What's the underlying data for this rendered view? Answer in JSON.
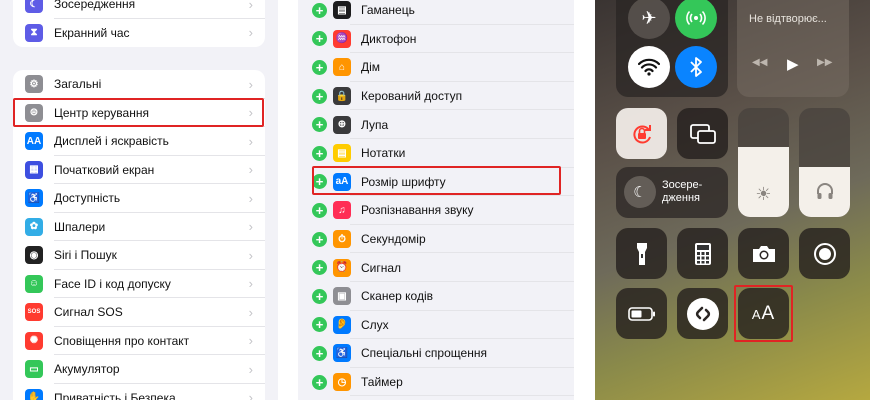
{
  "settings_top": {
    "items": [
      {
        "label": "Зосередження",
        "icon": "moon-icon",
        "color": "#5e5ce6",
        "glyph": "☾"
      },
      {
        "label": "Екранний час",
        "icon": "hourglass-icon",
        "color": "#5e5ce6",
        "glyph": "⧗"
      }
    ]
  },
  "settings_main": {
    "items": [
      {
        "label": "Загальні",
        "icon": "gear-icon",
        "color": "#8e8e93",
        "glyph": "⚙"
      },
      {
        "label": "Центр керування",
        "icon": "switches-icon",
        "color": "#8e8e93",
        "glyph": "⊜"
      },
      {
        "label": "Дисплей і яскравість",
        "icon": "text-size-icon",
        "color": "#007aff",
        "glyph": "AA"
      },
      {
        "label": "Початковий екран",
        "icon": "home-grid-icon",
        "color": "#3d4fe0",
        "glyph": "▦"
      },
      {
        "label": "Доступність",
        "icon": "accessibility-icon",
        "color": "#007aff",
        "glyph": "♿"
      },
      {
        "label": "Шпалери",
        "icon": "flower-icon",
        "color": "#32ade6",
        "glyph": "✿"
      },
      {
        "label": "Siri і Пошук",
        "icon": "siri-icon",
        "color": "#222",
        "glyph": "◉"
      },
      {
        "label": "Face ID і код допуску",
        "icon": "face-id-icon",
        "color": "#34c759",
        "glyph": "☺"
      },
      {
        "label": "Сигнал SOS",
        "icon": "sos-icon",
        "color": "#ff3b30",
        "glyph": "SOS"
      },
      {
        "label": "Сповіщення про контакт",
        "icon": "exposure-icon",
        "color": "#ff3b30",
        "glyph": "✺"
      },
      {
        "label": "Акумулятор",
        "icon": "battery-icon",
        "color": "#34c759",
        "glyph": "▭"
      },
      {
        "label": "Приватність і Безпека",
        "icon": "hand-icon",
        "color": "#007aff",
        "glyph": "✋"
      }
    ]
  },
  "controls": {
    "items": [
      {
        "label": "Гаманець",
        "icon": "wallet-icon",
        "color": "#1c1c1e",
        "glyph": "▤"
      },
      {
        "label": "Диктофон",
        "icon": "voice-memo-icon",
        "color": "#ff3b30",
        "glyph": "♒"
      },
      {
        "label": "Дім",
        "icon": "home-icon",
        "color": "#ff9500",
        "glyph": "⌂"
      },
      {
        "label": "Керований доступ",
        "icon": "lock-icon",
        "color": "#3a3a3c",
        "glyph": "🔒"
      },
      {
        "label": "Лупа",
        "icon": "magnifier-icon",
        "color": "#3a3a3c",
        "glyph": "⊕"
      },
      {
        "label": "Нотатки",
        "icon": "notes-icon",
        "color": "#ffcc00",
        "glyph": "▤"
      },
      {
        "label": "Розмір шрифту",
        "icon": "text-size-icon",
        "color": "#007aff",
        "glyph": "aA"
      },
      {
        "label": "Розпізнавання звуку",
        "icon": "sound-recognition-icon",
        "color": "#ff2d55",
        "glyph": "♫"
      },
      {
        "label": "Секундомір",
        "icon": "stopwatch-icon",
        "color": "#ff9500",
        "glyph": "⏱"
      },
      {
        "label": "Сигнал",
        "icon": "alarm-icon",
        "color": "#ff9500",
        "glyph": "⏰"
      },
      {
        "label": "Сканер кодів",
        "icon": "qr-scanner-icon",
        "color": "#8e8e93",
        "glyph": "▣"
      },
      {
        "label": "Слух",
        "icon": "ear-icon",
        "color": "#007aff",
        "glyph": "👂"
      },
      {
        "label": "Спеціальні спрощення",
        "icon": "accessibility-shortcut-icon",
        "color": "#007aff",
        "glyph": "♿"
      },
      {
        "label": "Таймер",
        "icon": "timer-icon",
        "color": "#ff9500",
        "glyph": "◷"
      }
    ]
  },
  "control_center": {
    "now_playing": "Не відтворює...",
    "focus_label": "Зосере-\nдження"
  }
}
